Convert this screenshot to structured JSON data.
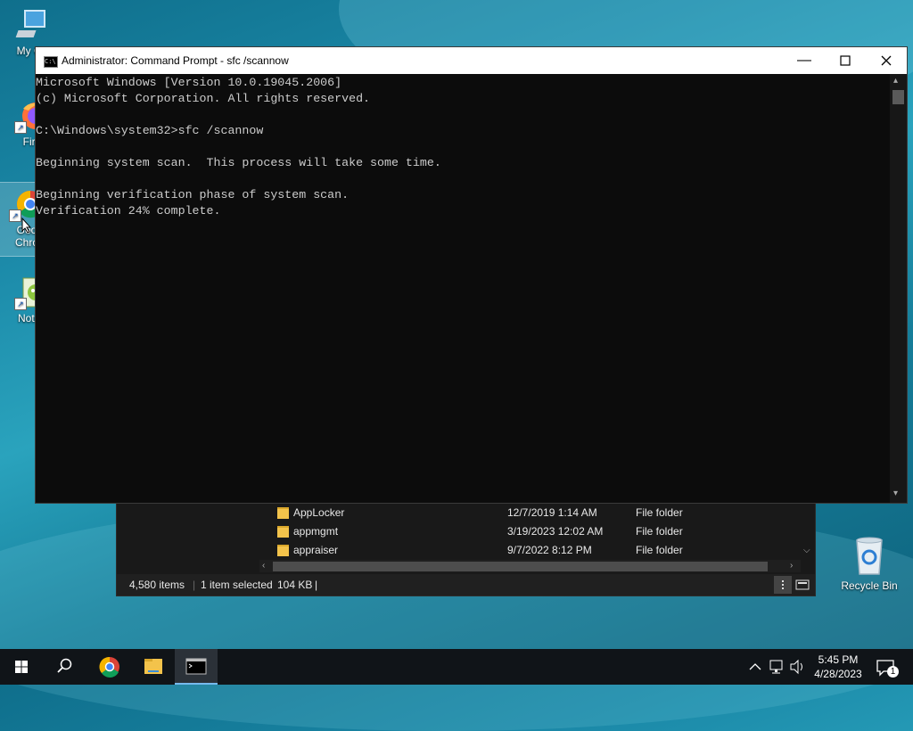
{
  "desktop": {
    "icons": [
      {
        "label": "My Co"
      },
      {
        "label": "Fire"
      },
      {
        "label": "Goo",
        "label2": "Chro"
      },
      {
        "label": "Notep"
      }
    ],
    "recycle_bin": "Recycle Bin"
  },
  "cmd": {
    "title": "Administrator: Command Prompt - sfc  /scannow",
    "lines": [
      "Microsoft Windows [Version 10.0.19045.2006]",
      "(c) Microsoft Corporation. All rights reserved.",
      "",
      "C:\\Windows\\system32>sfc /scannow",
      "",
      "Beginning system scan.  This process will take some time.",
      "",
      "Beginning verification phase of system scan.",
      "Verification 24% complete."
    ]
  },
  "explorer": {
    "rows": [
      {
        "name": "AppLocker",
        "date": "12/7/2019 1:14 AM",
        "type": "File folder"
      },
      {
        "name": "appmgmt",
        "date": "3/19/2023 12:02 AM",
        "type": "File folder"
      },
      {
        "name": "appraiser",
        "date": "9/7/2022 8:12 PM",
        "type": "File folder"
      }
    ],
    "status": {
      "items": "4,580 items",
      "selected": "1 item selected",
      "size": "104 KB"
    }
  },
  "taskbar": {
    "time": "5:45 PM",
    "date": "4/28/2023",
    "notification_count": "1"
  }
}
